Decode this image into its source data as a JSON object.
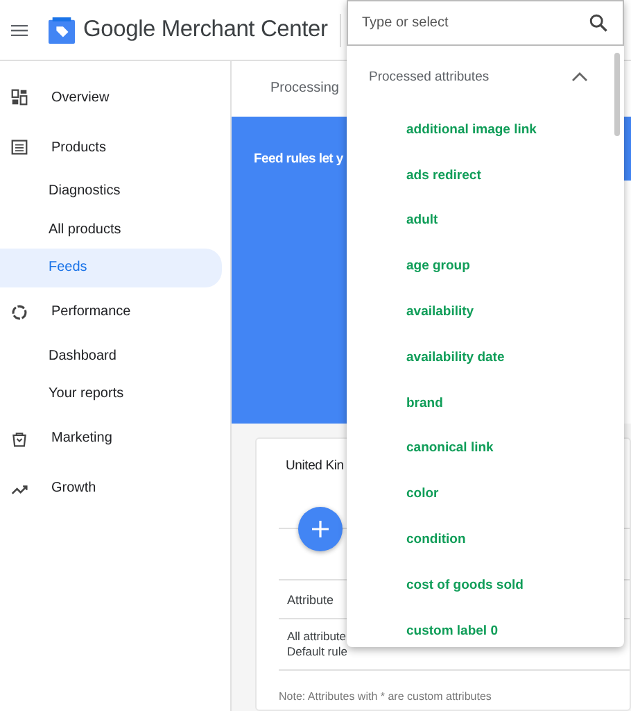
{
  "header": {
    "product_name": "Google Merchant Center"
  },
  "sidebar": {
    "items": [
      {
        "kind": "section",
        "label": "Overview",
        "selected": false
      },
      {
        "kind": "section",
        "label": "Products",
        "selected": false
      },
      {
        "kind": "sub",
        "label": "Diagnostics",
        "selected": false
      },
      {
        "kind": "sub",
        "label": "All products",
        "selected": false
      },
      {
        "kind": "sub",
        "label": "Feeds",
        "selected": true
      },
      {
        "kind": "section",
        "label": "Performance",
        "selected": false
      },
      {
        "kind": "sub",
        "label": "Dashboard",
        "selected": false
      },
      {
        "kind": "sub",
        "label": "Your reports",
        "selected": false
      },
      {
        "kind": "section",
        "label": "Marketing",
        "selected": false
      },
      {
        "kind": "section",
        "label": "Growth",
        "selected": false
      }
    ]
  },
  "tabs": [
    {
      "label": "Processing",
      "selected": false
    }
  ],
  "banner": {
    "text": "Feed rules let y"
  },
  "card": {
    "title": "United Kin",
    "columns": [
      "Attribute"
    ],
    "rows": [
      {
        "line_1": "All attribute",
        "line_2": "Default rule"
      }
    ],
    "note": "Note: Attributes with * are custom attributes"
  },
  "dropdown": {
    "placeholder": "Type or select",
    "group": {
      "label": "Processed attributes",
      "expanded": true,
      "options": [
        "additional image link",
        "ads redirect",
        "adult",
        "age group",
        "availability",
        "availability date",
        "brand",
        "canonical link",
        "color",
        "condition",
        "cost of goods sold",
        "custom label 0"
      ]
    }
  }
}
